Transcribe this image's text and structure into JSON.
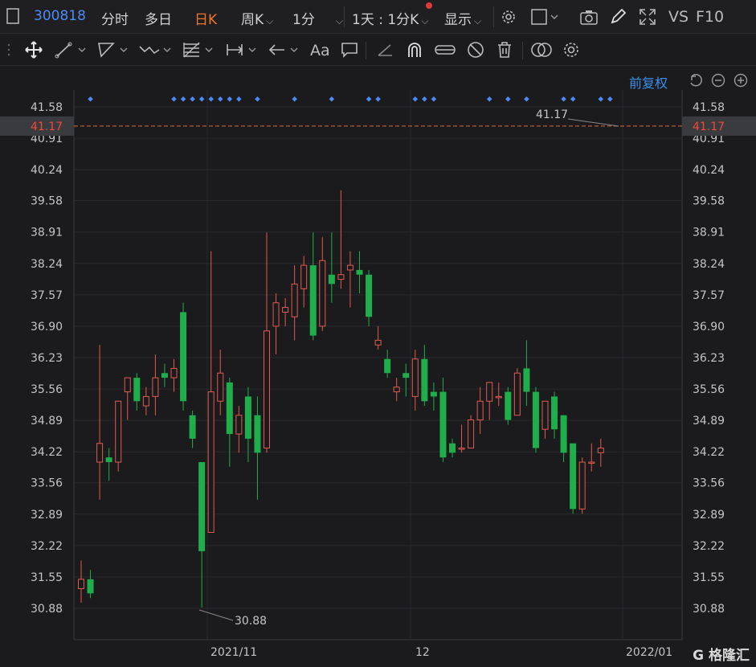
{
  "topbar": {
    "code": "300818",
    "tabs": [
      "分时",
      "多日",
      "日K",
      "周K",
      "1分"
    ],
    "active_tab": "日K",
    "period_select": "1天 : 1分K",
    "display": "显示",
    "vs": "VS",
    "f10": "F10"
  },
  "toolbar": {
    "font_tool": "Aa"
  },
  "right_controls": {
    "adjust": "前复权"
  },
  "colors": {
    "up": "#e05a4f",
    "down": "#1fae4b",
    "current_line": "#e46a3a",
    "marker": "#4c8bf5",
    "accent": "#4c8bf5"
  },
  "chart_data": {
    "type": "candlestick",
    "y_ticks": [
      "41.58",
      "40.91",
      "40.24",
      "39.58",
      "38.91",
      "38.24",
      "37.57",
      "36.90",
      "36.23",
      "35.56",
      "34.89",
      "34.22",
      "33.56",
      "32.89",
      "32.22",
      "31.55",
      "30.88"
    ],
    "ylim": [
      30.88,
      41.58
    ],
    "x_labels": [
      "2021/11",
      "12",
      "2022/01"
    ],
    "current_price": "41.17",
    "high_annotation": "41.17",
    "low_annotation": "30.88",
    "candles": [
      [
        31.3,
        31.5,
        31.0,
        31.9
      ],
      [
        31.5,
        31.2,
        31.1,
        31.7
      ],
      [
        34.0,
        34.4,
        33.2,
        36.5
      ],
      [
        34.1,
        34.0,
        33.6,
        34.3
      ],
      [
        34.0,
        35.3,
        33.8,
        35.3
      ],
      [
        35.5,
        35.8,
        34.9,
        35.8
      ],
      [
        35.8,
        35.3,
        35.1,
        35.9
      ],
      [
        35.2,
        35.4,
        35.0,
        35.6
      ],
      [
        35.4,
        35.8,
        35.0,
        36.3
      ],
      [
        35.9,
        35.8,
        35.6,
        36.1
      ],
      [
        35.8,
        36.0,
        35.5,
        36.2
      ],
      [
        37.2,
        35.3,
        35.1,
        37.4
      ],
      [
        35.0,
        34.5,
        34.3,
        35.1
      ],
      [
        34.0,
        32.1,
        30.9,
        34.0
      ],
      [
        32.5,
        35.5,
        32.5,
        38.5
      ],
      [
        35.3,
        35.9,
        35.0,
        36.4
      ],
      [
        35.7,
        34.6,
        33.9,
        35.8
      ],
      [
        34.6,
        35.0,
        34.2,
        35.2
      ],
      [
        35.4,
        34.5,
        34.0,
        35.6
      ],
      [
        35.0,
        34.2,
        33.2,
        35.4
      ],
      [
        34.3,
        36.8,
        34.2,
        38.9
      ],
      [
        36.9,
        37.4,
        36.3,
        37.6
      ],
      [
        37.2,
        37.3,
        36.9,
        37.5
      ],
      [
        37.1,
        37.8,
        36.6,
        38.2
      ],
      [
        37.7,
        38.2,
        37.3,
        38.4
      ],
      [
        38.2,
        36.7,
        36.6,
        38.9
      ],
      [
        36.9,
        38.3,
        36.8,
        38.8
      ],
      [
        38.0,
        37.8,
        37.4,
        38.9
      ],
      [
        37.9,
        38.0,
        37.7,
        39.8
      ],
      [
        38.1,
        38.2,
        37.3,
        38.5
      ],
      [
        38.1,
        38.0,
        37.6,
        38.5
      ],
      [
        38.0,
        37.1,
        36.9,
        38.1
      ],
      [
        36.5,
        36.6,
        36.4,
        36.9
      ],
      [
        36.2,
        35.9,
        35.8,
        36.4
      ],
      [
        35.5,
        35.6,
        35.3,
        35.8
      ],
      [
        35.9,
        35.8,
        35.4,
        36.1
      ],
      [
        35.4,
        36.2,
        35.1,
        36.4
      ],
      [
        36.2,
        35.3,
        35.2,
        36.5
      ],
      [
        35.5,
        35.4,
        35.1,
        35.7
      ],
      [
        35.5,
        34.1,
        34.0,
        35.8
      ],
      [
        34.4,
        34.2,
        34.1,
        34.5
      ],
      [
        34.3,
        34.3,
        34.2,
        34.8
      ],
      [
        34.3,
        34.9,
        34.3,
        35.0
      ],
      [
        34.9,
        35.3,
        34.6,
        35.6
      ],
      [
        35.3,
        35.7,
        34.9,
        35.7
      ],
      [
        35.4,
        35.4,
        35.2,
        35.7
      ],
      [
        35.5,
        34.9,
        34.8,
        35.6
      ],
      [
        35.0,
        35.9,
        35.0,
        36.0
      ],
      [
        36.0,
        35.5,
        35.2,
        36.6
      ],
      [
        35.5,
        34.3,
        34.2,
        35.6
      ],
      [
        34.7,
        35.3,
        34.5,
        35.3
      ],
      [
        35.4,
        34.7,
        34.5,
        35.5
      ],
      [
        35.0,
        34.2,
        34.0,
        35.0
      ],
      [
        34.4,
        33.0,
        32.9,
        34.4
      ],
      [
        33.0,
        34.0,
        32.9,
        34.1
      ],
      [
        34.0,
        34.0,
        33.8,
        34.4
      ],
      [
        34.2,
        34.3,
        33.9,
        34.5
      ]
    ]
  }
}
